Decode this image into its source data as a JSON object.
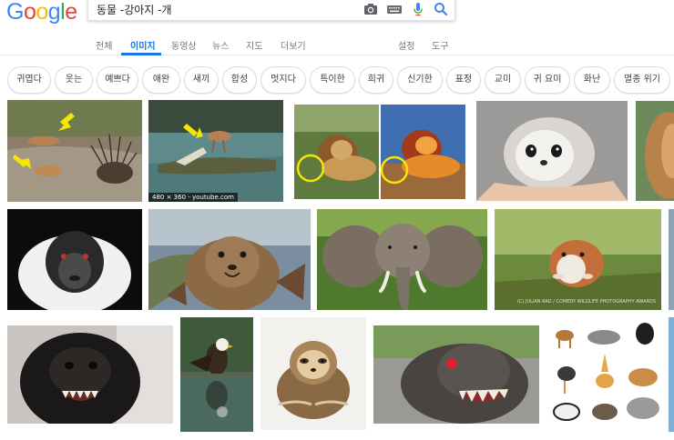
{
  "logo": {
    "letters": [
      "G",
      "o",
      "o",
      "g",
      "l",
      "e"
    ],
    "colors": [
      "#4285F4",
      "#EA4335",
      "#FBBC05",
      "#4285F4",
      "#34A853",
      "#EA4335"
    ]
  },
  "search": {
    "query": "동물 -강아지 -개"
  },
  "icons": [
    "camera-icon",
    "keyboard-icon",
    "microphone-icon",
    "search-icon"
  ],
  "nav": {
    "tabs": [
      {
        "label": "전체"
      },
      {
        "label": "이미지"
      },
      {
        "label": "동영상"
      },
      {
        "label": "뉴스"
      },
      {
        "label": "지도"
      },
      {
        "label": "더보기"
      }
    ],
    "settings": "설정",
    "tools": "도구",
    "active_color": "#1a73e8"
  },
  "chips": [
    "귀엽다",
    "웃는",
    "예쁘다",
    "애완",
    "새끼",
    "합성",
    "멋지다",
    "특이한",
    "희귀",
    "신기한",
    "표정",
    "교미",
    "귀 요미",
    "화난",
    "멸종 위기"
  ],
  "images": {
    "crocodile_caption": "480 × 360 - youtube.com",
    "hamster_watermark": "(C) JULIAN RAD / COMEDY WILDLIFE PHOTOGRAPHY AWARDS"
  }
}
